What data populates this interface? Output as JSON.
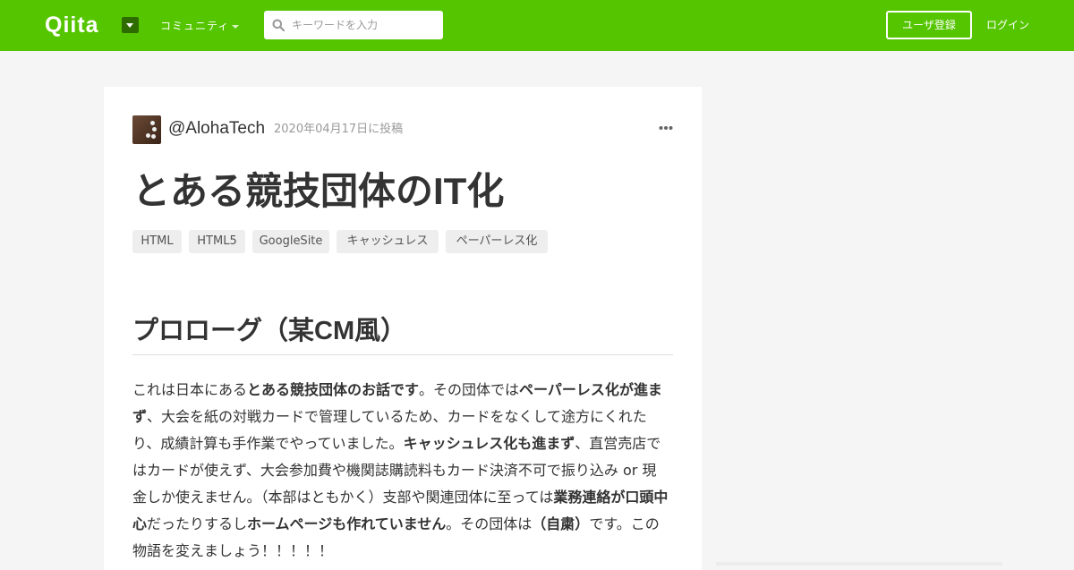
{
  "header": {
    "logo": "Qiita",
    "community_label": "コミュニティ",
    "search_placeholder": "キーワードを入力",
    "signup_label": "ユーザ登録",
    "login_label": "ログイン"
  },
  "article": {
    "author": "@AlohaTech",
    "posted": "2020年04月17日に投稿",
    "title": "とある競技団体のIT化",
    "tags": [
      "HTML",
      "HTML5",
      "GoogleSite",
      "キャッシュレス",
      "ペーパーレス化"
    ],
    "section_heading": "プロローグ（某CM風）",
    "paragraph": [
      {
        "text": "これは日本にある",
        "bold": false
      },
      {
        "text": "とある競技団体のお話です",
        "bold": true
      },
      {
        "text": "。その団体では",
        "bold": false
      },
      {
        "text": "ペーパーレス化が進まず",
        "bold": true
      },
      {
        "text": "、大会を紙の対戦カードで管理しているため、カードをなくして途方にくれたり、成績計算も手作業でやっていました。",
        "bold": false
      },
      {
        "text": "キャッシュレス化も進まず",
        "bold": true
      },
      {
        "text": "、直営売店ではカードが使えず、大会参加費や機関誌購読料もカード決済不可で振り込み or 現金しか使えません。（本部はともかく）支部や関連団体に至っては",
        "bold": false
      },
      {
        "text": "業務連絡が口頭中心",
        "bold": true
      },
      {
        "text": "だったりするし",
        "bold": false
      },
      {
        "text": "ホームページも作れていません",
        "bold": true
      },
      {
        "text": "。その団体は",
        "bold": false
      },
      {
        "text": "（自粛）",
        "bold": true
      },
      {
        "text": "です。この物語を変えましょう！！！！！",
        "bold": false
      }
    ]
  },
  "colors": {
    "brand_green": "#55c500",
    "menu_dark_green": "#2f6c00",
    "tag_bg": "#eeeeee",
    "page_bg": "#f5f5f5"
  }
}
